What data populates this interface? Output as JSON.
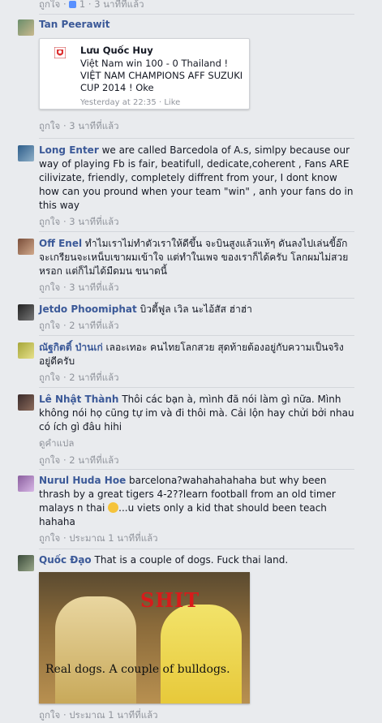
{
  "top_meta": {
    "like": "ถูกใจ",
    "sep": "·",
    "likes_icon": "thumb-up-icon",
    "like_count": "1",
    "time": "3 นาทีที่แล้ว"
  },
  "comments": [
    {
      "author": "Tan Peerawit",
      "text": "",
      "card": {
        "author": "Lưu Quốc Huy",
        "text": "Việt Nam win 100 - 0 Thailand ! VIỆT NAM CHAMPIONS AFF SUZUKI CUP 2014 ! Oke",
        "time": "Yesterday at 22:35",
        "sep": "·",
        "like": "Like"
      },
      "like": "ถูกใจ",
      "sep": "·",
      "time": "3 นาทีที่แล้ว"
    },
    {
      "author": "Long Enter",
      "text": "we are called Barcedola of A.s, simlpy because our way of playing Fb is fair, beatifull, dedicate,coherent , Fans ARE cilivizate, friendly, completely diffrent from your, I dont know how can you pround when your team \"win\" , anh your fans do in this way",
      "like": "ถูกใจ",
      "sep": "·",
      "time": "3 นาทีที่แล้ว"
    },
    {
      "author": "Off Enel",
      "text": "ทำไมเราไม่ทำตัวเราให้ดีขึ้น จะบินสูงแล้วแท้ๆ ดันลงไปเล่นขี้อ๊ก จะเกรียนจะเหน็บเขาผมเข้าใจ แต่ทำในเพจ ของเราก็ได้ครับ โลกผมไม่สวยหรอก แต่ก็ไม่ได้มืดมน ขนาดนี้",
      "like": "ถูกใจ",
      "sep": "·",
      "time": "3 นาทีที่แล้ว"
    },
    {
      "author": "Jetdo Phoomiphat",
      "text": "บิวตี้ฟูล เวิล นะไอ้สัส ฮ่าฮ่า",
      "like": "ถูกใจ",
      "sep": "·",
      "time": "2 นาทีที่แล้ว"
    },
    {
      "author": "ณัฐกิตติ์ ป่านเก่",
      "text": "เลอะเทอะ คนไทยโลกสวย สุดท้ายต้องอยู่กับความเป็นจริงอยู่ดีครับ",
      "like": "ถูกใจ",
      "sep": "·",
      "time": "2 นาทีที่แล้ว"
    },
    {
      "author": "Lê Nhật Thành",
      "text": "Thôi các bạn à, mình đã nói làm gì nữa. Mình không nói họ cũng tự im và đi thôi mà. Cải lộn hay chửi bởi nhau có ích gì đâu hihi",
      "translate": "ดูคำแปล",
      "like": "ถูกใจ",
      "sep": "·",
      "time": "2 นาทีที่แล้ว"
    },
    {
      "author": "Nurul Huda Hoe",
      "text": "barcelona?wahahahahaha but why been thrash by a great tigers 4-2??learn football from an old timer malays n thai",
      "text_after_emoji": "...u viets only a kid that should been teach hahaha",
      "emoji": "🙂",
      "like": "ถูกใจ",
      "sep": "·",
      "time": "ประมาณ 1 นาทีที่แล้ว"
    },
    {
      "author": "Quốc Đạo",
      "text": "That is a couple of dogs. Fuck thai land.",
      "photo": {
        "top_text": "SHIT",
        "bottom_text": "Real dogs. A couple of bulldogs."
      },
      "like": "ถูกใจ",
      "sep": "·",
      "time": "ประมาณ 1 นาทีที่แล้ว"
    }
  ],
  "colors": {
    "link": "#3b5998",
    "meta": "#90949c",
    "background": "#e9ebee"
  }
}
